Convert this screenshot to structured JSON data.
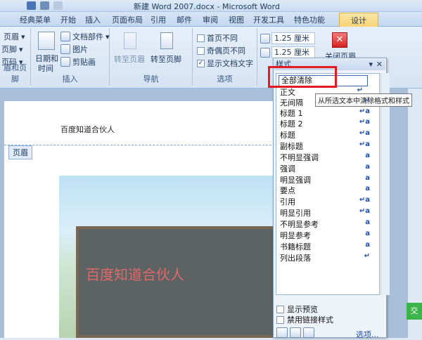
{
  "window": {
    "title": "新建 Word 2007.docx - Microsoft Word"
  },
  "ribbon_tabs": [
    "经典菜单",
    "开始",
    "插入",
    "页面布局",
    "引用",
    "邮件",
    "审阅",
    "视图",
    "开发工具",
    "特色功能",
    "设计"
  ],
  "groups": {
    "header_footer": {
      "label": "眉和页脚",
      "buttons": [
        "页眉",
        "页脚",
        "页码"
      ]
    },
    "insert": {
      "label": "插入",
      "date_time": [
        "日期和",
        "时间"
      ],
      "items": [
        "文档部件",
        "图片",
        "剪贴画"
      ]
    },
    "nav": {
      "label": "导航",
      "to_header": "转至页眉",
      "to_footer": "转至页脚"
    },
    "options": {
      "label": "选项",
      "items": [
        "首页不同",
        "奇偶页不同",
        "显示文档文字"
      ],
      "checked": [
        false,
        false,
        true
      ]
    },
    "position": {
      "values": [
        "1.25 厘米",
        "1.25 厘米"
      ]
    },
    "close": {
      "label": "关闭页眉"
    }
  },
  "document": {
    "header_text": "百度知道合伙人",
    "header_tag": "页眉",
    "watermark": "百度知道合伙人"
  },
  "styles_pane": {
    "title": "样式",
    "selected": "全部清除",
    "tooltip": "从所选文本中清除格式和样式",
    "items": [
      {
        "name": "正文",
        "mark": "↵"
      },
      {
        "name": "无间隔",
        "mark": "↵"
      },
      {
        "name": "标题 1",
        "mark": "↵a"
      },
      {
        "name": "标题 2",
        "mark": "↵a"
      },
      {
        "name": "标题",
        "mark": "↵a"
      },
      {
        "name": "副标题",
        "mark": "↵a"
      },
      {
        "name": "不明显强调",
        "mark": "a"
      },
      {
        "name": "强调",
        "mark": "a"
      },
      {
        "name": "明显强调",
        "mark": "a"
      },
      {
        "name": "要点",
        "mark": "a"
      },
      {
        "name": "引用",
        "mark": "↵a"
      },
      {
        "name": "明显引用",
        "mark": "↵a"
      },
      {
        "name": "不明显参考",
        "mark": "a"
      },
      {
        "name": "明显参考",
        "mark": "a"
      },
      {
        "name": "书籍标题",
        "mark": "a"
      },
      {
        "name": "列出段落",
        "mark": "↵"
      }
    ],
    "show_preview": "显示预览",
    "disable_linked": "禁用链接样式",
    "options_link": "选项..."
  },
  "side_button": "交",
  "colors": {
    "highlight": "#e51b24",
    "accent": "#1e395b"
  }
}
